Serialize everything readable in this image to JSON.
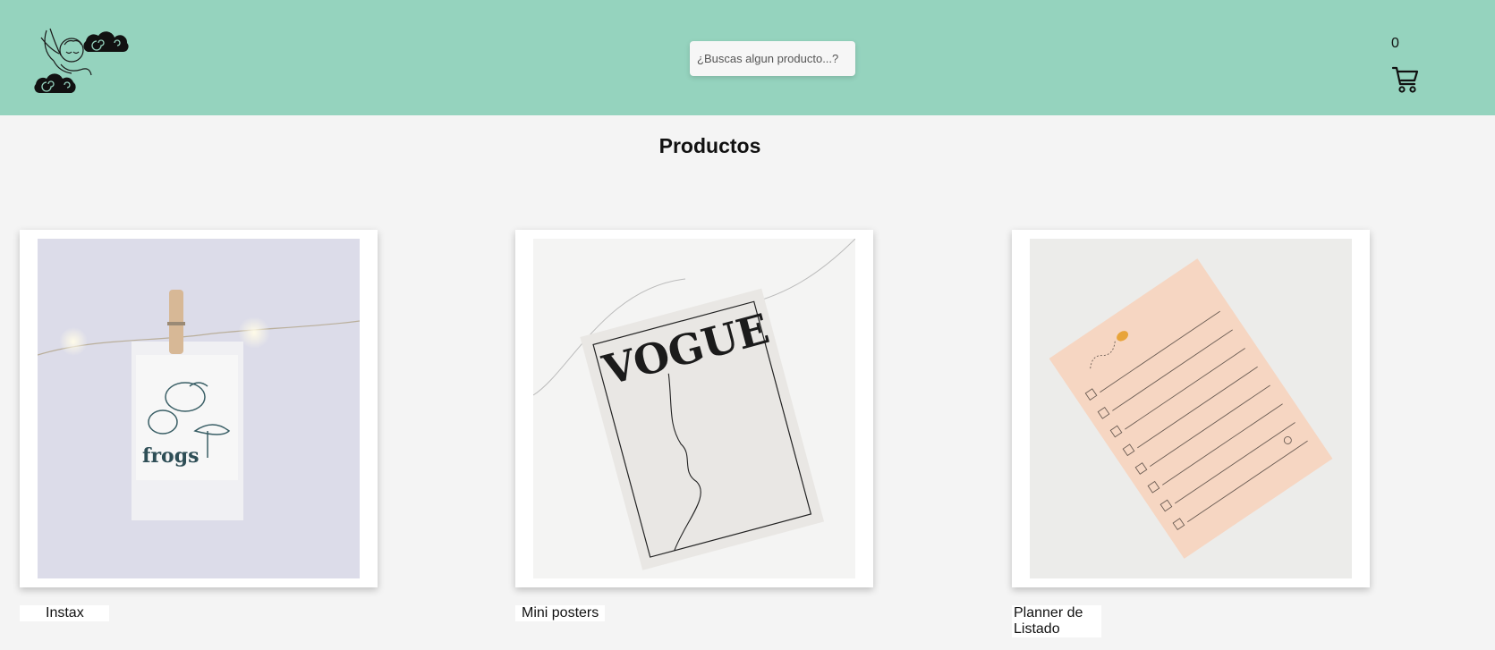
{
  "header": {
    "logo_icon": "cherub-clouds-logo-icon",
    "search_placeholder": "¿Buscas algun producto...?",
    "cart_count": "0",
    "cart_icon": "shopping-cart-icon"
  },
  "main": {
    "title": "Productos",
    "products": [
      {
        "name": "Instax",
        "image": "polaroid-frogs-photo"
      },
      {
        "name": "Mini posters",
        "image": "vogue-poster-photo"
      },
      {
        "name": "Planner de Listado",
        "image": "checklist-planner-photo"
      }
    ]
  },
  "colors": {
    "header_bg": "#95d3be",
    "page_bg": "#f4f4f4",
    "card_bg": "#ffffff"
  }
}
